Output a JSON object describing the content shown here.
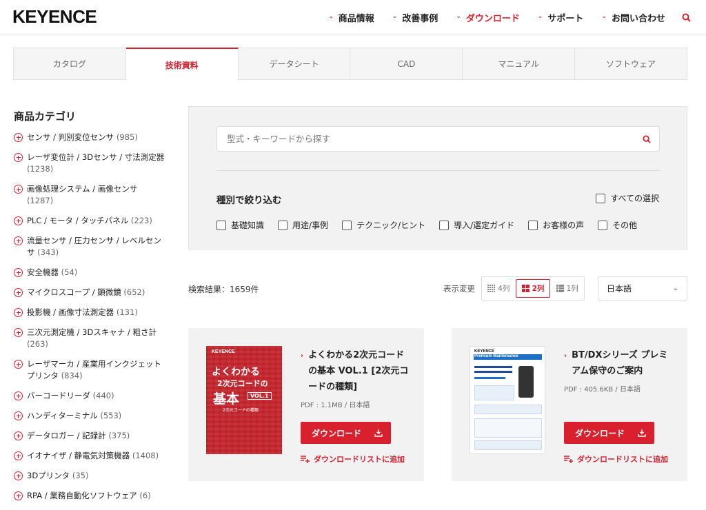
{
  "header": {
    "logo": "KEYENCE",
    "nav": [
      {
        "label": "商品情報",
        "active": false
      },
      {
        "label": "改善事例",
        "active": false
      },
      {
        "label": "ダウンロード",
        "active": true
      },
      {
        "label": "サポート",
        "active": false
      },
      {
        "label": "お問い合わせ",
        "active": false
      }
    ],
    "search_icon": "search-icon"
  },
  "tabs": [
    {
      "label": "カタログ",
      "active": false
    },
    {
      "label": "技術資料",
      "active": true
    },
    {
      "label": "データシート",
      "active": false
    },
    {
      "label": "CAD",
      "active": false
    },
    {
      "label": "マニュアル",
      "active": false
    },
    {
      "label": "ソフトウェア",
      "active": false
    }
  ],
  "sidebar": {
    "title": "商品カテゴリ",
    "items": [
      {
        "label": "センサ / 判別変位センサ",
        "count": "(985)"
      },
      {
        "label": "レーザ変位計 / 3Dセンサ / 寸法測定器",
        "count": "(1238)"
      },
      {
        "label": "画像処理システム / 画像センサ",
        "count": "(1287)"
      },
      {
        "label": "PLC / モータ / タッチパネル",
        "count": "(223)"
      },
      {
        "label": "流量センサ / 圧力センサ / レベルセンサ",
        "count": "(343)"
      },
      {
        "label": "安全機器",
        "count": "(54)"
      },
      {
        "label": "マイクロスコープ / 顕微鏡",
        "count": "(652)"
      },
      {
        "label": "投影機 / 画像寸法測定器",
        "count": "(131)"
      },
      {
        "label": "三次元測定機 / 3Dスキャナ / 粗さ計",
        "count": "(263)"
      },
      {
        "label": "レーザマーカ / 産業用インクジェットプリンタ",
        "count": "(834)"
      },
      {
        "label": "バーコードリーダ",
        "count": "(440)"
      },
      {
        "label": "ハンディターミナル",
        "count": "(553)"
      },
      {
        "label": "データロガー / 記録計",
        "count": "(375)"
      },
      {
        "label": "イオナイザ / 静電気対策機器",
        "count": "(1408)"
      },
      {
        "label": "3Dプリンタ",
        "count": "(35)"
      },
      {
        "label": "RPA / 業務自動化ソフトウェア",
        "count": "(6)"
      }
    ]
  },
  "filter": {
    "search_placeholder": "型式・キーワードから探す",
    "title": "種別で絞り込む",
    "select_all": "すべての選択",
    "options": [
      "基礎知識",
      "用途/事例",
      "テクニック/ヒント",
      "導入/選定ガイド",
      "お客様の声",
      "その他"
    ]
  },
  "results": {
    "count_text": "検索結果：1659件",
    "view_label": "表示変更",
    "views": [
      {
        "label": "4列",
        "active": false
      },
      {
        "label": "2列",
        "active": true
      },
      {
        "label": "1列",
        "active": false
      }
    ],
    "language": "日本語"
  },
  "cards": [
    {
      "title": "よくわかる2次元コードの基本 VOL.1 [2次元コードの種類]",
      "meta": "PDF : 1.1MB / 日本語",
      "download": "ダウンロード",
      "add_list": "ダウンロードリストに追加",
      "thumb": {
        "logo": "KEYENCE",
        "t1": "よくわかる",
        "t2": "2次元コードの",
        "t3": "基本",
        "vol": "VOL.1",
        "sub": "2次元コードの種類"
      }
    },
    {
      "title": "BT/DXシリーズ プレミアム保守のご案内",
      "meta": "PDF : 405.6KB / 日本語",
      "download": "ダウンロード",
      "add_list": "ダウンロードリストに追加",
      "thumb": {
        "logo": "KEYENCE",
        "band": "Premium Maintenance"
      }
    }
  ],
  "colors": {
    "accent": "#d8202f",
    "panel": "#f2f2f2"
  }
}
